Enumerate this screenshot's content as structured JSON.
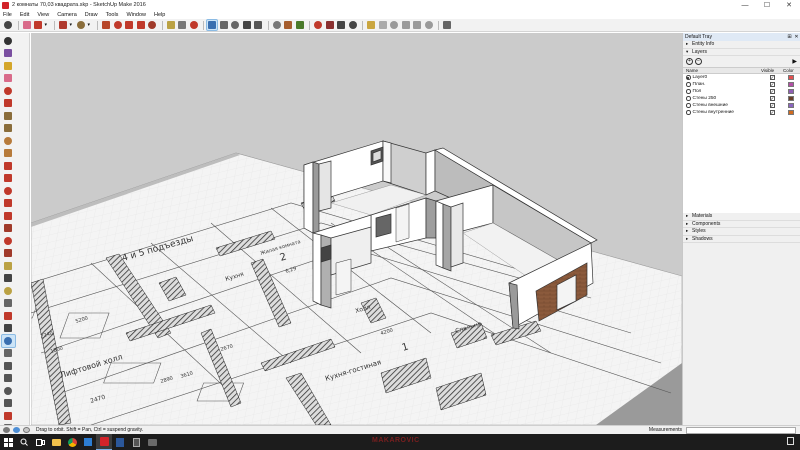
{
  "window": {
    "title": "2 комнаты 70,03 квадрата.skp - SketchUp Make 2016",
    "minimize": "—",
    "maximize": "☐",
    "close": "✕"
  },
  "menu": [
    "File",
    "Edit",
    "View",
    "Camera",
    "Draw",
    "Tools",
    "Window",
    "Help"
  ],
  "toolbar": {
    "icons": [
      "select-icon",
      "eraser-icon",
      "pencil-icon",
      "chevron-down-icon",
      "arc-icon",
      "chevron-down-icon",
      "rectangle-icon",
      "chevron-down-icon",
      "push-pull-icon",
      "move-icon",
      "rotate-icon",
      "scale-icon",
      "offset-icon",
      "tape-measure-icon",
      "text-icon",
      "axes-icon",
      "orbit-icon",
      "pan-icon",
      "zoom-icon",
      "zoom-extents-icon",
      "previous-view-icon",
      "paint-bucket-icon",
      "components-icon",
      "warehouse-icon",
      "extension-icon",
      "3d-warehouse-icon",
      "share-model-icon",
      "styles-icon",
      "iso-view-icon",
      "top-view-icon",
      "front-view-icon",
      "right-view-icon",
      "back-view-icon",
      "left-view-icon",
      "section-icon"
    ]
  },
  "lefttoolbar": {
    "icons": [
      "select-icon",
      "make-component-icon",
      "paint-bucket-icon",
      "eraser-icon",
      "line-icon",
      "freehand-icon",
      "rectangle-icon",
      "rotated-rectangle-icon",
      "circle-icon",
      "polygon-icon",
      "arc-icon",
      "pie-icon",
      "move-icon",
      "push-pull-icon",
      "rotate-icon",
      "follow-me-icon",
      "scale-icon",
      "offset-icon",
      "tape-measure-icon",
      "dimension-icon",
      "protractor-icon",
      "text-icon",
      "axes-icon",
      "3d-text-icon",
      "orbit-icon",
      "pan-icon",
      "zoom-icon",
      "zoom-window-icon",
      "zoom-extents-icon",
      "previous-icon",
      "position-camera-icon",
      "look-around-icon",
      "walk-icon",
      "section-plane-icon"
    ],
    "active_index": 24
  },
  "tray": {
    "title": "Default Tray",
    "panels_top": [
      "Entity Info",
      "Layers"
    ],
    "layers": {
      "columns": {
        "name": "Name",
        "visible": "Visible",
        "color": "Color"
      },
      "rows": [
        {
          "name": "Layer0",
          "active": true,
          "visible": true,
          "color": "#e45050"
        },
        {
          "name": "План.",
          "active": false,
          "visible": true,
          "color": "#b34fa6"
        },
        {
          "name": "Пол",
          "active": false,
          "visible": true,
          "color": "#8f5fb5"
        },
        {
          "name": "Стены 250",
          "active": false,
          "visible": true,
          "color": "#6a3f2a"
        },
        {
          "name": "Стены внешние",
          "active": false,
          "visible": true,
          "color": "#8a65c0"
        },
        {
          "name": "Стены внутренние",
          "active": false,
          "visible": true,
          "color": "#d16b1f"
        }
      ]
    },
    "panels_bottom": [
      "Materials",
      "Components",
      "Styles",
      "Shadows"
    ]
  },
  "status": {
    "message": "Drag to orbit. Shift = Pan, Ctrl = suspend gravity.",
    "measurements_label": "Measurements",
    "measurements_value": ""
  },
  "plan_labels": {
    "entrance": "4 и 5 подъезды",
    "lift_hall": "Лифтовой холл",
    "kitchen1": "Кухня",
    "kitchen_living": "Кухня-гостиная",
    "living": "Жилая комната",
    "bedroom": "Спальня",
    "hall": "Холл",
    "d1": "6,29",
    "d2": "1800",
    "d3": "2240",
    "d4": "5200",
    "d5": "2470",
    "d6": "2890",
    "d7": "4200",
    "d8": "2",
    "d9": "1",
    "d10": "2670",
    "d11": "3610"
  },
  "taskbar": {
    "watermark": "MAKAROVIC"
  },
  "colors": {
    "viewport_bg": "#cbcbcb",
    "ground": "#f4f4f4",
    "wall_top": "#ffffff",
    "wall_shade": "#bdbdbd",
    "wall_dark": "#8e8e8e",
    "brick": "#8b5a3c",
    "accent": "#cce4f7"
  }
}
